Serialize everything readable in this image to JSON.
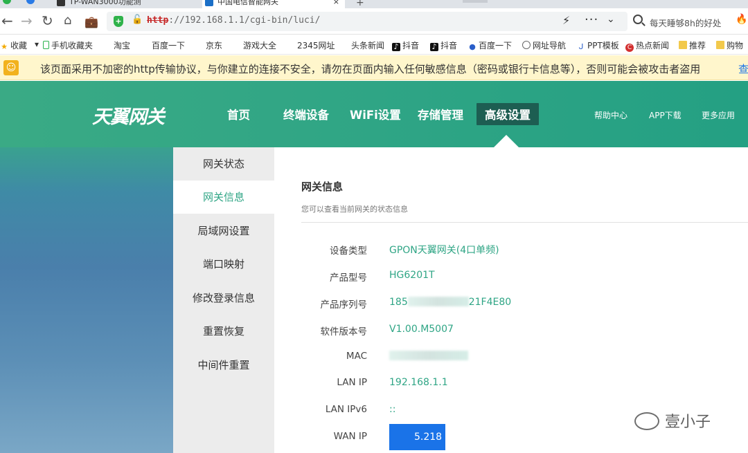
{
  "browser": {
    "tabs": [
      {
        "label": "TP-WAN3000功能测"
      },
      {
        "label": "中国电信智能网关"
      }
    ],
    "url_protocol": "http",
    "url_rest": "://192.168.1.1/cgi-bin/luci/",
    "search_placeholder": "每天睡够8h的好处",
    "bookmarks": [
      {
        "label": "收藏",
        "icon": "star-icon"
      },
      {
        "label": "手机收藏夹",
        "icon": "phone-icon"
      },
      {
        "label": "淘宝"
      },
      {
        "label": "百度一下"
      },
      {
        "label": "京东"
      },
      {
        "label": "游戏大全"
      },
      {
        "label": "2345网址"
      },
      {
        "label": "头条新闻"
      },
      {
        "label": "抖音",
        "icon": "tiktok-icon"
      },
      {
        "label": "抖音",
        "icon": "tiktok-icon"
      },
      {
        "label": "百度一下",
        "icon": "paw-icon"
      },
      {
        "label": "网址导航",
        "icon": "globe-icon"
      },
      {
        "label": "PPT模板",
        "icon": "ppt-icon"
      },
      {
        "label": "热点新闻",
        "icon": "hot-icon"
      },
      {
        "label": "推荐",
        "icon": "folder-icon"
      },
      {
        "label": "购物",
        "icon": "folder-icon"
      }
    ],
    "warning_text": "该页面采用不加密的http传输协议，与你建立的连接不安全，请勿在页面内输入任何敏感信息（密码或银行卡信息等），否则可能会被攻击者盗用",
    "warning_link": "查"
  },
  "gateway": {
    "logo": "天翼网关",
    "nav": [
      "首页",
      "终端设备",
      "WiFi设置",
      "存储管理",
      "高级设置"
    ],
    "active_nav": "高级设置",
    "subnav": [
      "帮助中心",
      "APP下载",
      "更多应用"
    ],
    "sidebar": [
      "网关状态",
      "网关信息",
      "局域网设置",
      "端口映射",
      "修改登录信息",
      "重置恢复",
      "中间件重置"
    ],
    "active_sidebar": "网关信息",
    "section_title": "网关信息",
    "section_subtitle": "您可以查看当前网关的状态信息",
    "info": [
      {
        "label": "设备类型",
        "value": "GPON天翼网关(4口单频)"
      },
      {
        "label": "产品型号",
        "value": "HG6201T"
      },
      {
        "label": "产品序列号",
        "value_visible_prefix": "185",
        "value_visible_suffix": "21F4E80"
      },
      {
        "label": "软件版本号",
        "value": "V1.00.M5007"
      },
      {
        "label": "MAC",
        "value": ""
      },
      {
        "label": "LAN IP",
        "value": "192.168.1.1"
      },
      {
        "label": "LAN IPv6",
        "value": "::"
      },
      {
        "label": "WAN IP",
        "value_visible_suffix": "5.218"
      }
    ]
  },
  "watermark": "壹小子",
  "colors": {
    "brand_green": "#2fa585",
    "active_nav_bg": "#1d5e52",
    "warning_bg": "#fff6cc",
    "selection_blue": "#1a73e8"
  }
}
